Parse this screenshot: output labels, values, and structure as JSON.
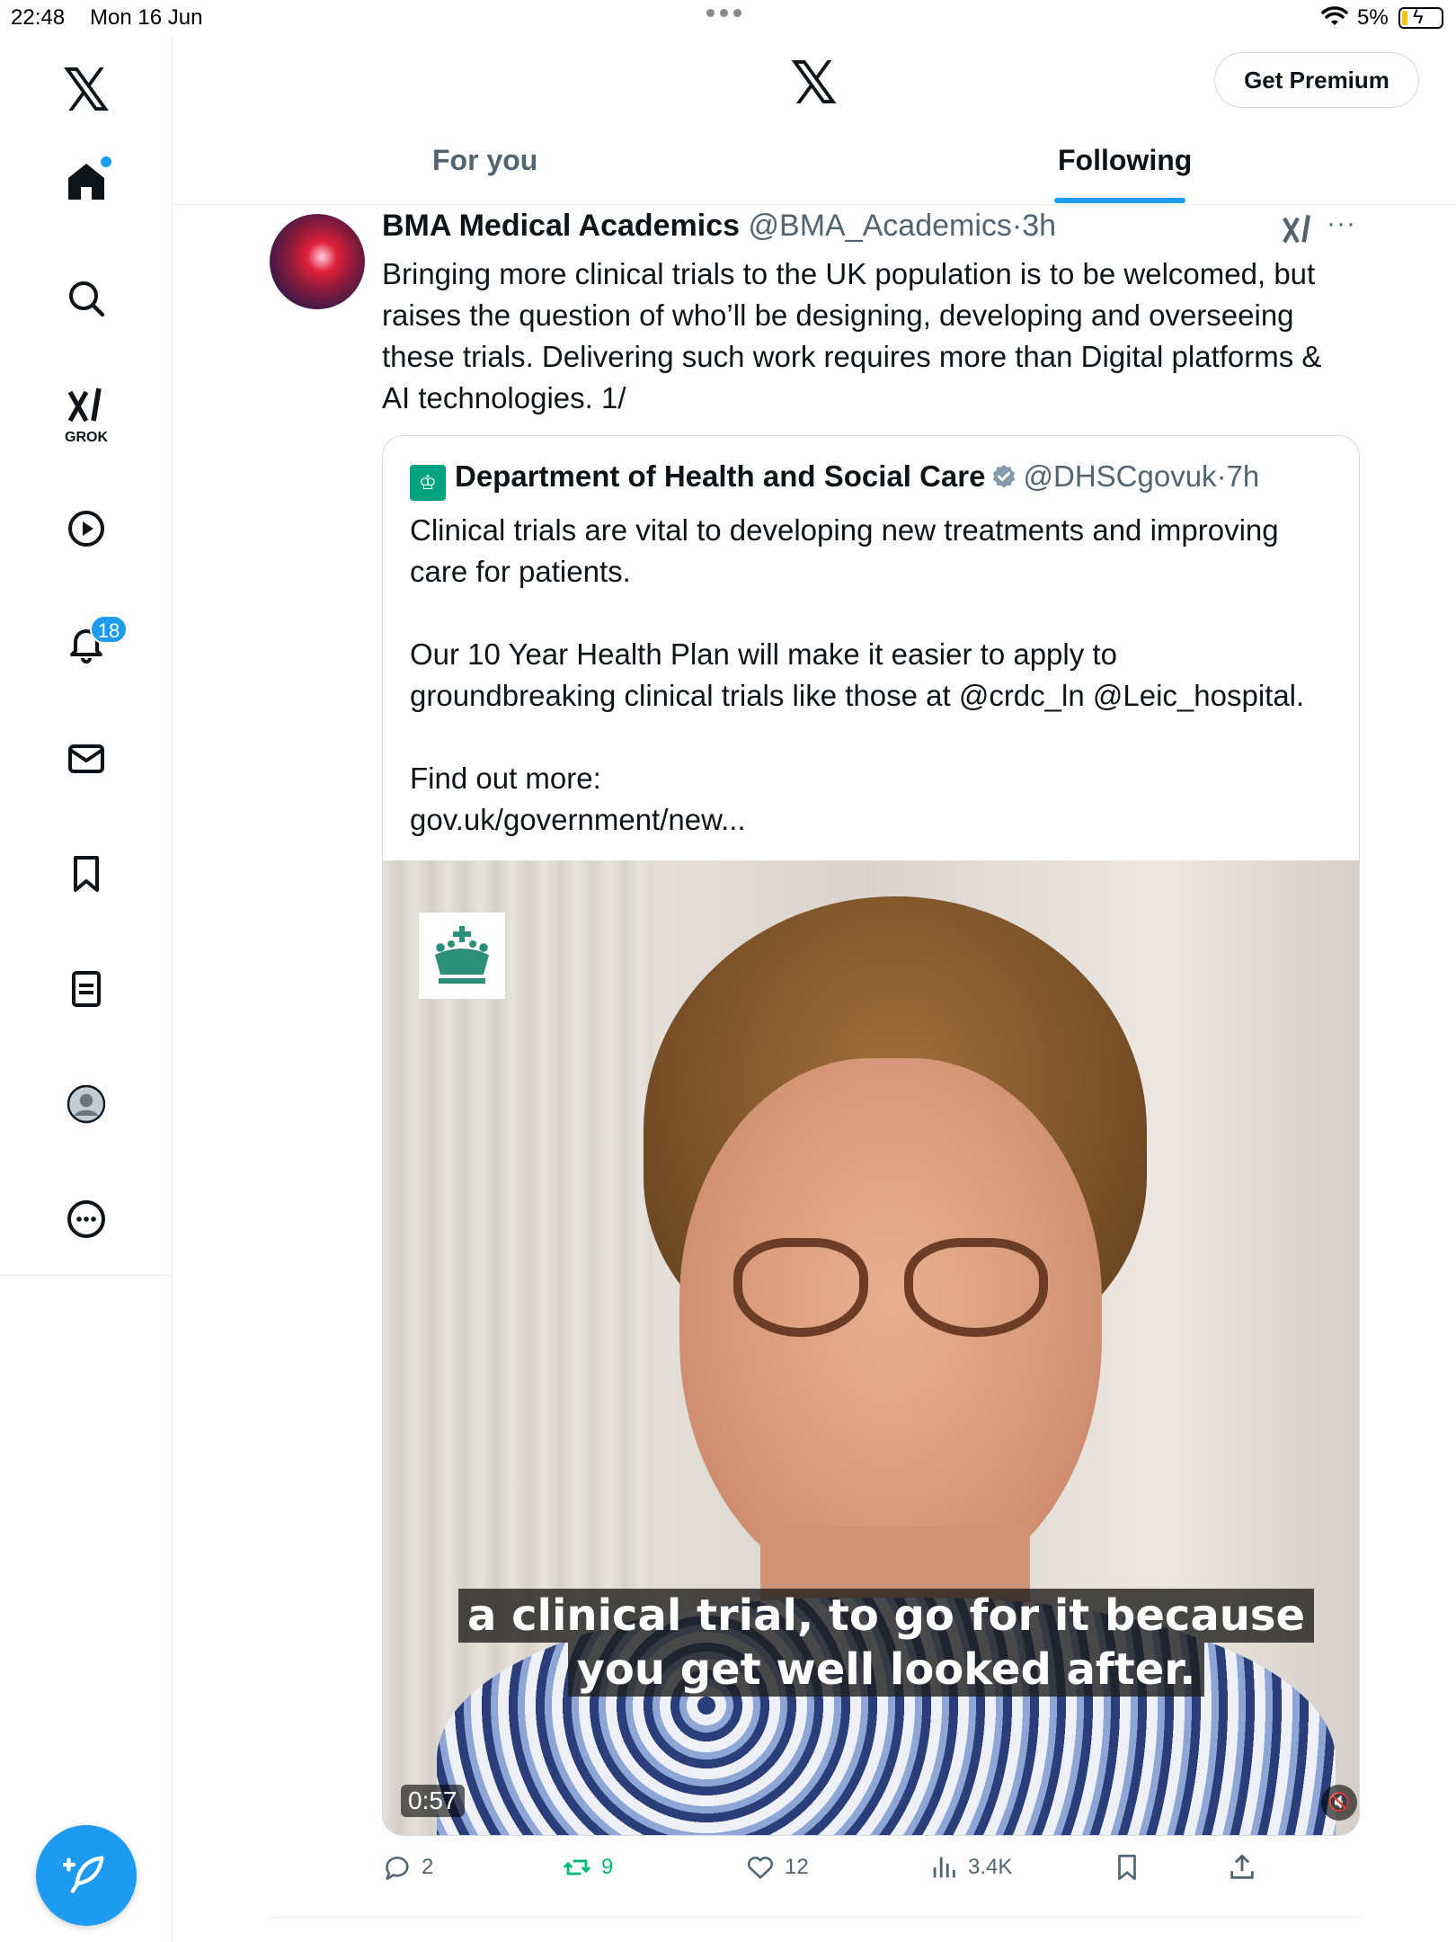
{
  "status": {
    "time": "22:48",
    "date": "Mon 16 Jun",
    "battery": "5%"
  },
  "sidebar": {
    "logo": "𝕏",
    "grok_label": "GROK",
    "notification_badge": "18",
    "items": [
      "home-icon",
      "search-icon",
      "grok-icon",
      "video-icon",
      "bell-icon",
      "mail-icon",
      "bookmark-icon",
      "article-icon",
      "profile-icon",
      "more-icon"
    ]
  },
  "header": {
    "logo": "𝕏",
    "premium_label": "Get Premium",
    "tabs": [
      {
        "label": "For you",
        "active": false
      },
      {
        "label": "Following",
        "active": true
      }
    ]
  },
  "post": {
    "name": "BMA Medical Academics",
    "handle": "@BMA_Academics",
    "time": "·3h",
    "text": "Bringing more clinical trials to the UK population is to be welcomed, but\nraises the question of who’ll be designing, developing and overseeing\nthese trials. Delivering such work requires more than Digital platforms &\nAI technologies. 1/",
    "quote": {
      "name": "Department of Health and Social Care",
      "handle": "@DHSCgovuk",
      "time": "·7h",
      "text": "Clinical trials are vital to developing new treatments and improving\ncare for patients.\n\nOur 10 Year Health Plan will make it easier to apply to\ngroundbreaking clinical trials like those at @crdc_ln @Leic_hospital.\n\nFind out more:\ngov.uk/government/new...",
      "video": {
        "caption_line1": "a clinical trial, to go for it because",
        "caption_line2": "you get well looked after.",
        "duration": "0:57"
      }
    },
    "actions": {
      "replies": "2",
      "reposts": "9",
      "likes": "12",
      "views": "3.4K"
    }
  },
  "colors": {
    "accent": "#1d9bf0",
    "repost": "#00ba7c",
    "muted": "#536471",
    "dhsc_green": "#00a37f"
  }
}
